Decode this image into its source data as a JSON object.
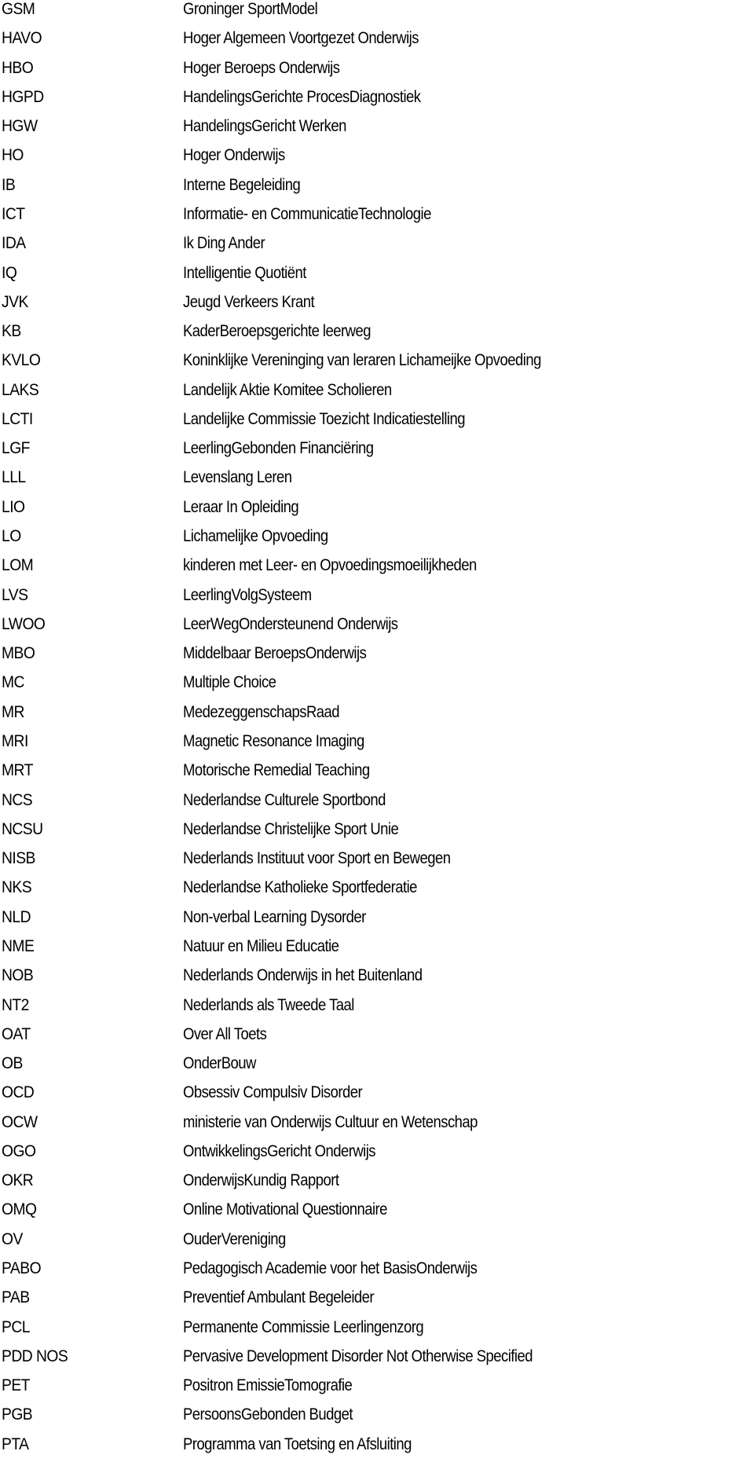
{
  "glossary": {
    "entries": [
      {
        "abbr": "GSM",
        "definition": "Groninger SportModel"
      },
      {
        "abbr": "HAVO",
        "definition": "Hoger Algemeen Voortgezet Onderwijs"
      },
      {
        "abbr": "HBO",
        "definition": "Hoger Beroeps Onderwijs"
      },
      {
        "abbr": "HGPD",
        "definition": "HandelingsGerichte ProcesDiagnostiek"
      },
      {
        "abbr": "HGW",
        "definition": "HandelingsGericht Werken"
      },
      {
        "abbr": "HO",
        "definition": "Hoger Onderwijs"
      },
      {
        "abbr": "IB",
        "definition": "Interne Begeleiding"
      },
      {
        "abbr": "ICT",
        "definition": "Informatie- en CommunicatieTechnologie"
      },
      {
        "abbr": "IDA",
        "definition": "Ik Ding Ander"
      },
      {
        "abbr": "IQ",
        "definition": "Intelligentie Quotiënt"
      },
      {
        "abbr": "JVK",
        "definition": "Jeugd Verkeers Krant"
      },
      {
        "abbr": "KB",
        "definition": "KaderBeroepsgerichte leerweg"
      },
      {
        "abbr": "KVLO",
        "definition": "Koninklijke Vereninging van leraren Lichameijke Opvoeding"
      },
      {
        "abbr": "LAKS",
        "definition": "Landelijk Aktie Komitee Scholieren"
      },
      {
        "abbr": "LCTI",
        "definition": "Landelijke Commissie Toezicht Indicatiestelling"
      },
      {
        "abbr": "LGF",
        "definition": "LeerlingGebonden Financiëring"
      },
      {
        "abbr": "LLL",
        "definition": "Levenslang Leren"
      },
      {
        "abbr": "LIO",
        "definition": "Leraar In Opleiding"
      },
      {
        "abbr": "LO",
        "definition": "Lichamelijke Opvoeding"
      },
      {
        "abbr": "LOM",
        "definition": "kinderen met Leer- en Opvoedingsmoeilijkheden"
      },
      {
        "abbr": "LVS",
        "definition": "LeerlingVolgSysteem"
      },
      {
        "abbr": "LWOO",
        "definition": "LeerWegOndersteunend Onderwijs"
      },
      {
        "abbr": "MBO",
        "definition": "Middelbaar BeroepsOnderwijs"
      },
      {
        "abbr": "MC",
        "definition": "Multiple Choice"
      },
      {
        "abbr": "MR",
        "definition": "MedezeggenschapsRaad"
      },
      {
        "abbr": "MRI",
        "definition": "Magnetic Resonance Imaging"
      },
      {
        "abbr": "MRT",
        "definition": "Motorische Remedial Teaching"
      },
      {
        "abbr": "NCS",
        "definition": "Nederlandse Culturele Sportbond"
      },
      {
        "abbr": "NCSU",
        "definition": "Nederlandse Christelijke Sport Unie"
      },
      {
        "abbr": "NISB",
        "definition": "Nederlands Instituut voor Sport en Bewegen"
      },
      {
        "abbr": "NKS",
        "definition": "Nederlandse Katholieke Sportfederatie"
      },
      {
        "abbr": "NLD",
        "definition": "Non-verbal Learning Dysorder"
      },
      {
        "abbr": "NME",
        "definition": "Natuur en Milieu Educatie"
      },
      {
        "abbr": "NOB",
        "definition": "Nederlands Onderwijs in het Buitenland"
      },
      {
        "abbr": "NT2",
        "definition": "Nederlands als Tweede Taal"
      },
      {
        "abbr": "OAT",
        "definition": "Over All Toets"
      },
      {
        "abbr": "OB",
        "definition": "OnderBouw"
      },
      {
        "abbr": "OCD",
        "definition": "Obsessiv Compulsiv Disorder"
      },
      {
        "abbr": "OCW",
        "definition": "ministerie van Onderwijs Cultuur en Wetenschap"
      },
      {
        "abbr": "OGO",
        "definition": "OntwikkelingsGericht Onderwijs"
      },
      {
        "abbr": "OKR",
        "definition": "OnderwijsKundig Rapport"
      },
      {
        "abbr": "OMQ",
        "definition": "Online Motivational Questionnaire"
      },
      {
        "abbr": "OV",
        "definition": "OuderVereniging"
      },
      {
        "abbr": "PABO",
        "definition": "Pedagogisch Academie voor het BasisOnderwijs"
      },
      {
        "abbr": "PAB",
        "definition": "Preventief Ambulant Begeleider"
      },
      {
        "abbr": "PCL",
        "definition": "Permanente Commissie Leerlingenzorg"
      },
      {
        "abbr": "PDD NOS",
        "definition": "Pervasive Development Disorder Not Otherwise Specified"
      },
      {
        "abbr": "PET",
        "definition": "Positron EmissieTomografie"
      },
      {
        "abbr": "PGB",
        "definition": "PersoonsGebonden Budget"
      },
      {
        "abbr": "PTA",
        "definition": "Programma van Toetsing en Afsluiting"
      }
    ]
  }
}
